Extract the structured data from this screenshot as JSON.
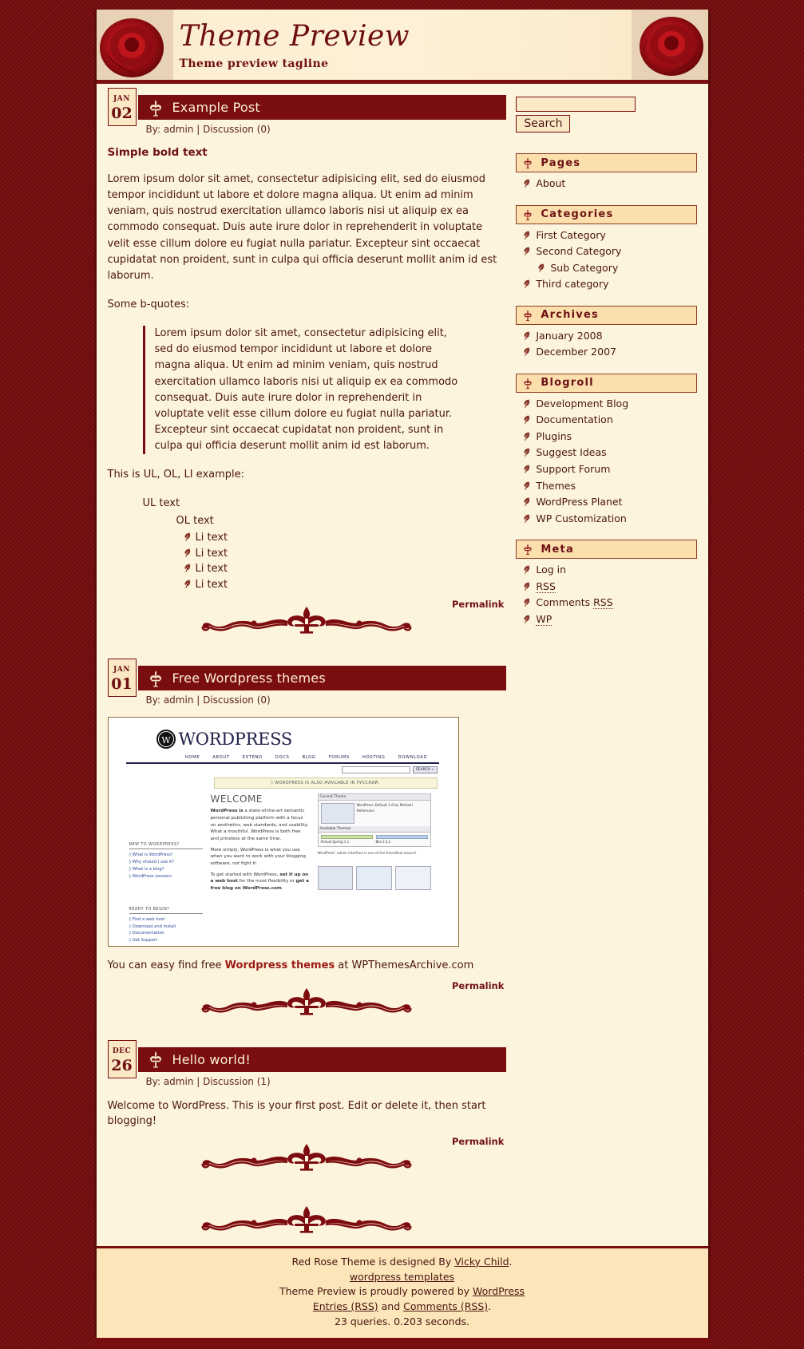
{
  "header": {
    "title": "Theme Preview",
    "tagline": "Theme preview tagline",
    "rose_left_icon": "rose-icon",
    "rose_right_icon": "rose-icon"
  },
  "posts": [
    {
      "date_month": "JAN",
      "date_day": "02",
      "title": "Example Post",
      "meta": "By: admin | Discussion (0)",
      "heading": "Simple bold text",
      "paragraph": "Lorem ipsum dolor sit amet, consectetur adipisicing elit, sed do eiusmod tempor incididunt ut labore et dolore magna aliqua. Ut enim ad minim veniam, quis nostrud exercitation ullamco laboris nisi ut aliquip ex ea commodo consequat. Duis aute irure dolor in reprehenderit in voluptate velit esse cillum dolore eu fugiat nulla pariatur. Excepteur sint occaecat cupidatat non proident, sunt in culpa qui officia deserunt mollit anim id est laborum.",
      "quote_intro": "Some b-quotes:",
      "blockquote": "Lorem ipsum dolor sit amet, consectetur adipisicing elit, sed do eiusmod tempor incididunt ut labore et dolore magna aliqua. Ut enim ad minim veniam, quis nostrud exercitation ullamco laboris nisi ut aliquip ex ea commodo consequat. Duis aute irure dolor in reprehenderit in voluptate velit esse cillum dolore eu fugiat nulla pariatur. Excepteur sint occaecat cupidatat non proident, sunt in culpa qui officia deserunt mollit anim id est laborum.",
      "list_intro": "This is UL, OL, LI example:",
      "ul_text": "UL text",
      "ol_text": "OL text",
      "li_items": [
        "Li text",
        "Li text",
        "Li text",
        "Li text"
      ],
      "permalink": "Permalink"
    },
    {
      "date_month": "JAN",
      "date_day": "01",
      "title": "Free Wordpress themes",
      "meta": "By: admin | Discussion (0)",
      "caption_pre": "You can easy find free ",
      "caption_hl": "Wordpress themes",
      "caption_post": " at WPThemesArchive.com",
      "permalink": "Permalink"
    },
    {
      "date_month": "DEC",
      "date_day": "26",
      "title": "Hello world!",
      "meta": "By: admin | Discussion (1)",
      "body": "Welcome to WordPress. This is your first post. Edit or delete it, then start blogging!",
      "permalink": "Permalink"
    }
  ],
  "wp_screenshot": {
    "logo_text": "WORDPRESS",
    "nav": [
      "HOME",
      "ABOUT",
      "EXTEND",
      "DOCS",
      "BLOG",
      "FORUMS",
      "HOSTING",
      "DOWNLOAD"
    ],
    "search_placeholder": "",
    "search_button": "SEARCH »",
    "notice": "◊ WORDPRESS IS ALSO AVAILABLE IN РУССКИЙ.",
    "welcome_title": "WELCOME",
    "intro_bold": "WordPress is",
    "intro_rest": " a state-of-the-art semantic personal publishing platform with a focus on aesthetics, web standards, and usability. What a mouthful. WordPress is both free and priceless at the same time.",
    "para2": "More simply, WordPress is what you use when you want to work with your blogging software, not fight it.",
    "para3_pre": "To get started with WordPress, ",
    "para3_b1": "set it up on a web host",
    "para3_mid": " for the most flexibility or ",
    "para3_b2": "get a free blog on WordPress.com",
    "para3_end": ".",
    "box1_head": "NEW TO WORDPRESS?",
    "box1_links": [
      "What is WordPress?",
      "Why should I use it?",
      "What is a blog?",
      "WordPress Lessons"
    ],
    "box2_head": "READY TO BEGIN?",
    "box2_links": [
      "Find a web host",
      "Download and Install",
      "Documentation",
      "Get Support"
    ],
    "panel_head": "Current Theme",
    "panel_caption": "WordPress Default 1.6 by Michael Heilemann",
    "panel_sub": "WordPress' admin interface is one of the friendliest around.",
    "panel2_head": "Available Themes",
    "theme1": "Almost Spring 1.1",
    "theme2": "Blix 1.0.2"
  },
  "sidebar": {
    "search": {
      "value": "",
      "placeholder": "",
      "button_label": "Search"
    },
    "widgets": [
      {
        "title": "Pages",
        "items": [
          {
            "label": "About",
            "depth": 0
          }
        ]
      },
      {
        "title": "Categories",
        "items": [
          {
            "label": "First Category",
            "depth": 0
          },
          {
            "label": "Second Category",
            "depth": 0
          },
          {
            "label": "Sub Category",
            "depth": 1
          },
          {
            "label": "Third category",
            "depth": 0
          }
        ]
      },
      {
        "title": "Archives",
        "items": [
          {
            "label": "January 2008",
            "depth": 0
          },
          {
            "label": "December 2007",
            "depth": 0
          }
        ]
      },
      {
        "title": "Blogroll",
        "items": [
          {
            "label": "Development Blog",
            "depth": 0
          },
          {
            "label": "Documentation",
            "depth": 0
          },
          {
            "label": "Plugins",
            "depth": 0
          },
          {
            "label": "Suggest Ideas",
            "depth": 0
          },
          {
            "label": "Support Forum",
            "depth": 0
          },
          {
            "label": "Themes",
            "depth": 0
          },
          {
            "label": "WordPress Planet",
            "depth": 0
          },
          {
            "label": "WP Customization",
            "depth": 0
          }
        ]
      },
      {
        "title": "Meta",
        "items": [
          {
            "label": "Log in",
            "depth": 0
          },
          {
            "label": "RSS",
            "depth": 0,
            "abbr": true
          },
          {
            "label": "Comments RSS",
            "depth": 0,
            "abbr_tail": "RSS"
          },
          {
            "label": "WP",
            "depth": 0,
            "abbr": true
          }
        ]
      }
    ]
  },
  "footer": {
    "line1_pre": "Red Rose Theme is designed By ",
    "line1_link": "Vicky Child",
    "line1_post": ".",
    "line2_link": "wordpress templates",
    "line3_pre": "Theme Preview is proudly powered by ",
    "line3_link": "WordPress",
    "line4_link1": "Entries (RSS)",
    "line4_mid": " and ",
    "line4_link2": "Comments (RSS)",
    "line4_end": ".",
    "line5": "23 queries. 0.203 seconds."
  },
  "colors": {
    "brand_red": "#7a0d10",
    "cream": "#fdf4de",
    "cream_dark": "#fbe5b9",
    "text": "#4a1512"
  }
}
